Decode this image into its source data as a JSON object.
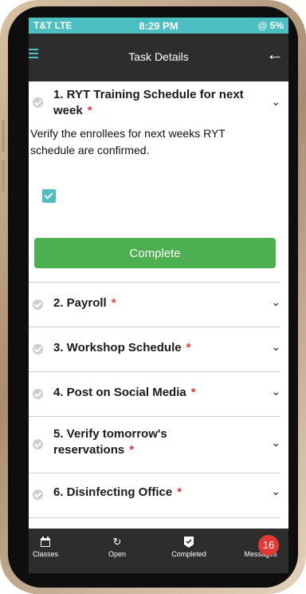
{
  "status_bar": {
    "carrier": "T&T  LTE",
    "time": "8:29 PM",
    "battery": "@ 5%"
  },
  "nav": {
    "title": "Task Details"
  },
  "tasks": [
    {
      "title_line1": "1. RYT Training Schedule for next",
      "title_line2": "week",
      "required": "*",
      "description_line1": "Verify the enrollees for next weeks RYT",
      "description_line2": "schedule are confirmed.",
      "complete_label": "Complete"
    },
    {
      "title": "2. Payroll",
      "required": "*"
    },
    {
      "title": "3. Workshop Schedule",
      "required": "*"
    },
    {
      "title": "4. Post on Social Media",
      "required": "*"
    },
    {
      "title_line1": "5. Verify tomorrow's",
      "title_line2": "reservations",
      "required": "*"
    },
    {
      "title": "6. Disinfecting Office",
      "required": "*"
    }
  ],
  "bottom_nav": {
    "classes": "Classes",
    "open": "Open",
    "completed": "Completed",
    "messages": "Messages",
    "messages_count": "16"
  },
  "colors": {
    "accent": "#4bbfc1",
    "complete": "#4caf50",
    "required": "#e53935",
    "bar": "#2d2d2d"
  }
}
